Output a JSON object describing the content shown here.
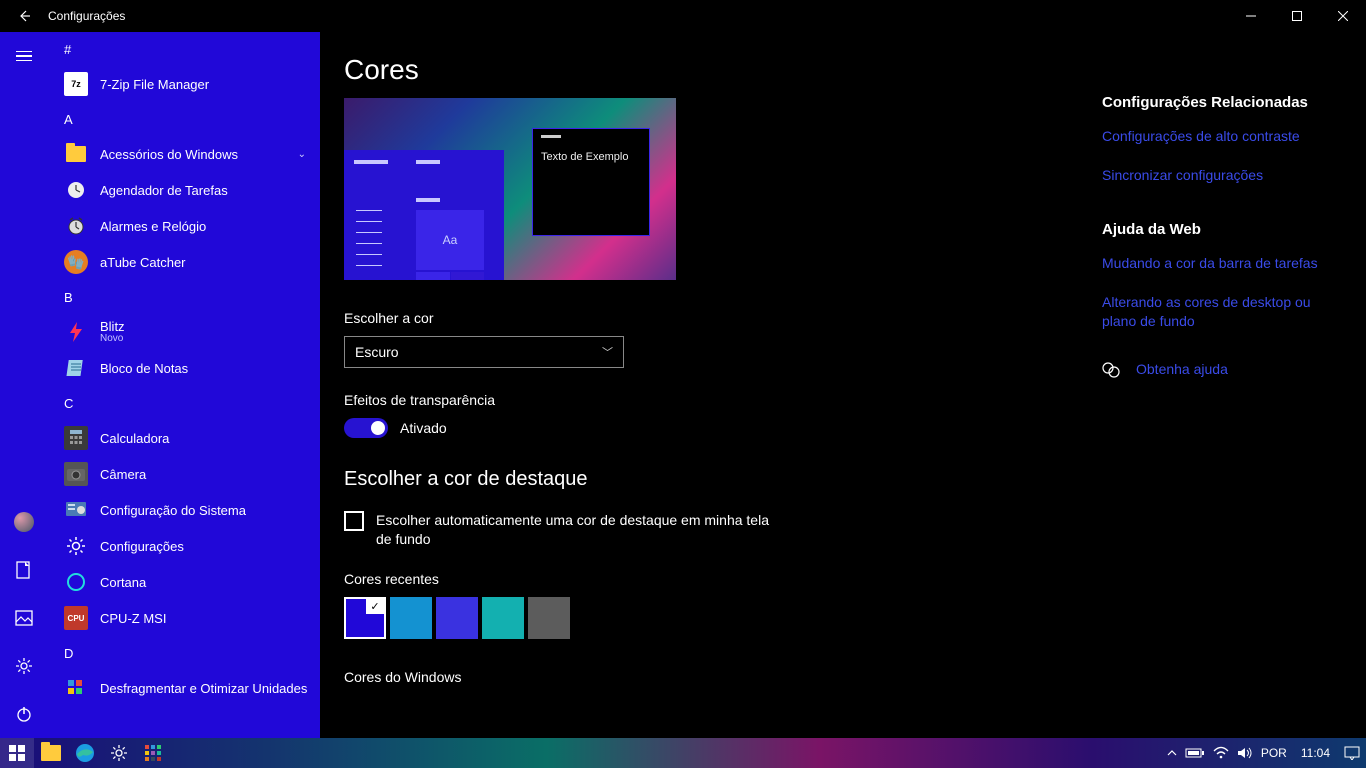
{
  "window": {
    "title": "Configurações",
    "page_heading": "Cores",
    "preview_sample": "Texto de Exemplo",
    "choose_color_label": "Escolher a cor",
    "choose_color_value": "Escuro",
    "transparency_label": "Efeitos de transparência",
    "toggle_state": "Ativado",
    "accent_heading": "Escolher a cor de destaque",
    "auto_pick_label": "Escolher automaticamente uma cor de destaque em minha tela de fundo",
    "recent_colors_label": "Cores recentes",
    "windows_colors_label": "Cores do Windows",
    "recent_swatches": [
      "#2108d8",
      "#1492d1",
      "#3a32e0",
      "#13b0b0",
      "#5c5c5c"
    ]
  },
  "aside": {
    "related_heading": "Configurações Relacionadas",
    "link_contrast": "Configurações de alto contraste",
    "link_sync": "Sincronizar configurações",
    "web_help_heading": "Ajuda da Web",
    "link_taskbar_color": "Mudando a cor da barra de tarefas",
    "link_desktop_bg": "Alterando as cores de desktop ou plano de fundo",
    "get_help": "Obtenha ajuda"
  },
  "start": {
    "group_hash": "#",
    "group_a": "A",
    "group_b": "B",
    "group_c": "C",
    "group_d": "D",
    "apps": {
      "sevenzip": "7-Zip File Manager",
      "acessorios": "Acessórios do Windows",
      "agendador": "Agendador de Tarefas",
      "alarmes": "Alarmes e Relógio",
      "atube": "aTube Catcher",
      "blitz": "Blitz",
      "blitz_sub": "Novo",
      "bloco": "Bloco de Notas",
      "calculadora": "Calculadora",
      "camera": "Câmera",
      "config_sistema": "Configuração do Sistema",
      "config": "Configurações",
      "cortana": "Cortana",
      "cpuz": "CPU-Z MSI",
      "desfrag": "Desfragmentar e Otimizar Unidades"
    }
  },
  "taskbar": {
    "lang": "POR",
    "clock": "11:04"
  }
}
